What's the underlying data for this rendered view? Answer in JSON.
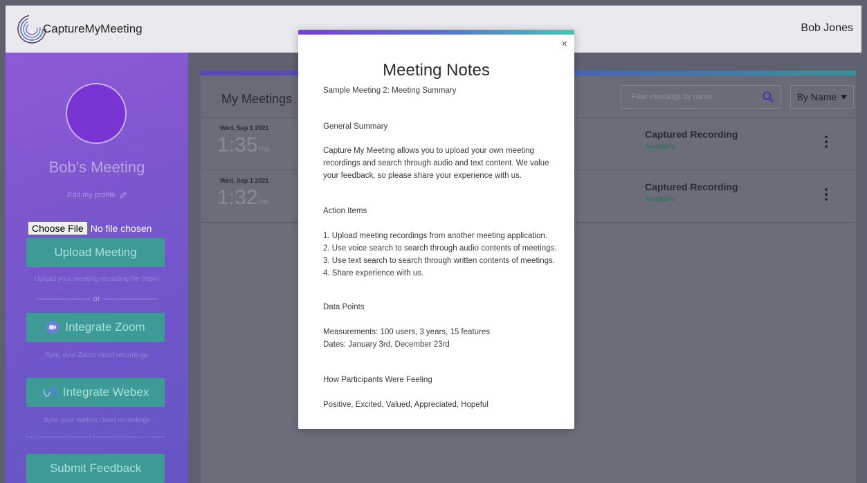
{
  "header": {
    "app_name": "CaptureMyMeeting",
    "user_name": "Bob Jones"
  },
  "sidebar": {
    "profile_name": "Bob's Meeting",
    "edit_profile": "Edit my profile",
    "choose_file": "Choose File",
    "no_file": "No file chosen",
    "upload_button": "Upload Meeting",
    "upload_hint": "Upload your meeting recording file (mp4)",
    "or_divider": "------------------- or -------------------",
    "zoom_button": "Integrate Zoom",
    "zoom_hint": "Sync your Zoom cloud recordings",
    "webex_button": "Integrate Webex",
    "webex_hint": "Sync your Webex cloud recordings",
    "feedback_button": "Submit Feedback"
  },
  "main": {
    "title": "My Meetings",
    "filter_placeholder": "Filter meetings by name",
    "sort_label": "By Name",
    "meetings": [
      {
        "date": "Wed, Sep 1 2021",
        "time": "1:35",
        "ampm": "PM",
        "recording_title": "Captured Recording",
        "status": "Available"
      },
      {
        "date": "Wed, Sep 1 2021",
        "time": "1:32",
        "ampm": "PM",
        "recording_title": "Captured Recording",
        "status": "Available"
      }
    ]
  },
  "modal": {
    "title": "Meeting Notes",
    "subtitle": "Sample Meeting 2: Meeting Summary",
    "sections": [
      {
        "heading": "General Summary",
        "lines": [
          "Capture My Meeting allows you to upload your own meeting",
          "recordings and search through audio and text content. We value",
          "your feedback, so please share your experience with us."
        ]
      },
      {
        "heading": "Action Items",
        "lines": [
          "1. Upload meeting recordings from another meeting application.",
          "2. Use voice search to search through audio contents of meetings.",
          "3. Use text search to search through written contents of meetings.",
          "4. Share experience with us."
        ]
      },
      {
        "heading": "Data Points",
        "lines": [
          "Measurements: 100 users, 3 years, 15 features",
          "Dates: January 3rd, December 23rd"
        ]
      },
      {
        "heading": "How Participants Were Feeling",
        "lines": [
          "Positive, Excited, Valued, Appreciated, Hopeful"
        ]
      }
    ],
    "close_symbol": "×"
  },
  "colors": {
    "accent_teal": "#3d9a95",
    "sidebar_purple": "#7c56cf",
    "status_green": "#2e6f56"
  }
}
